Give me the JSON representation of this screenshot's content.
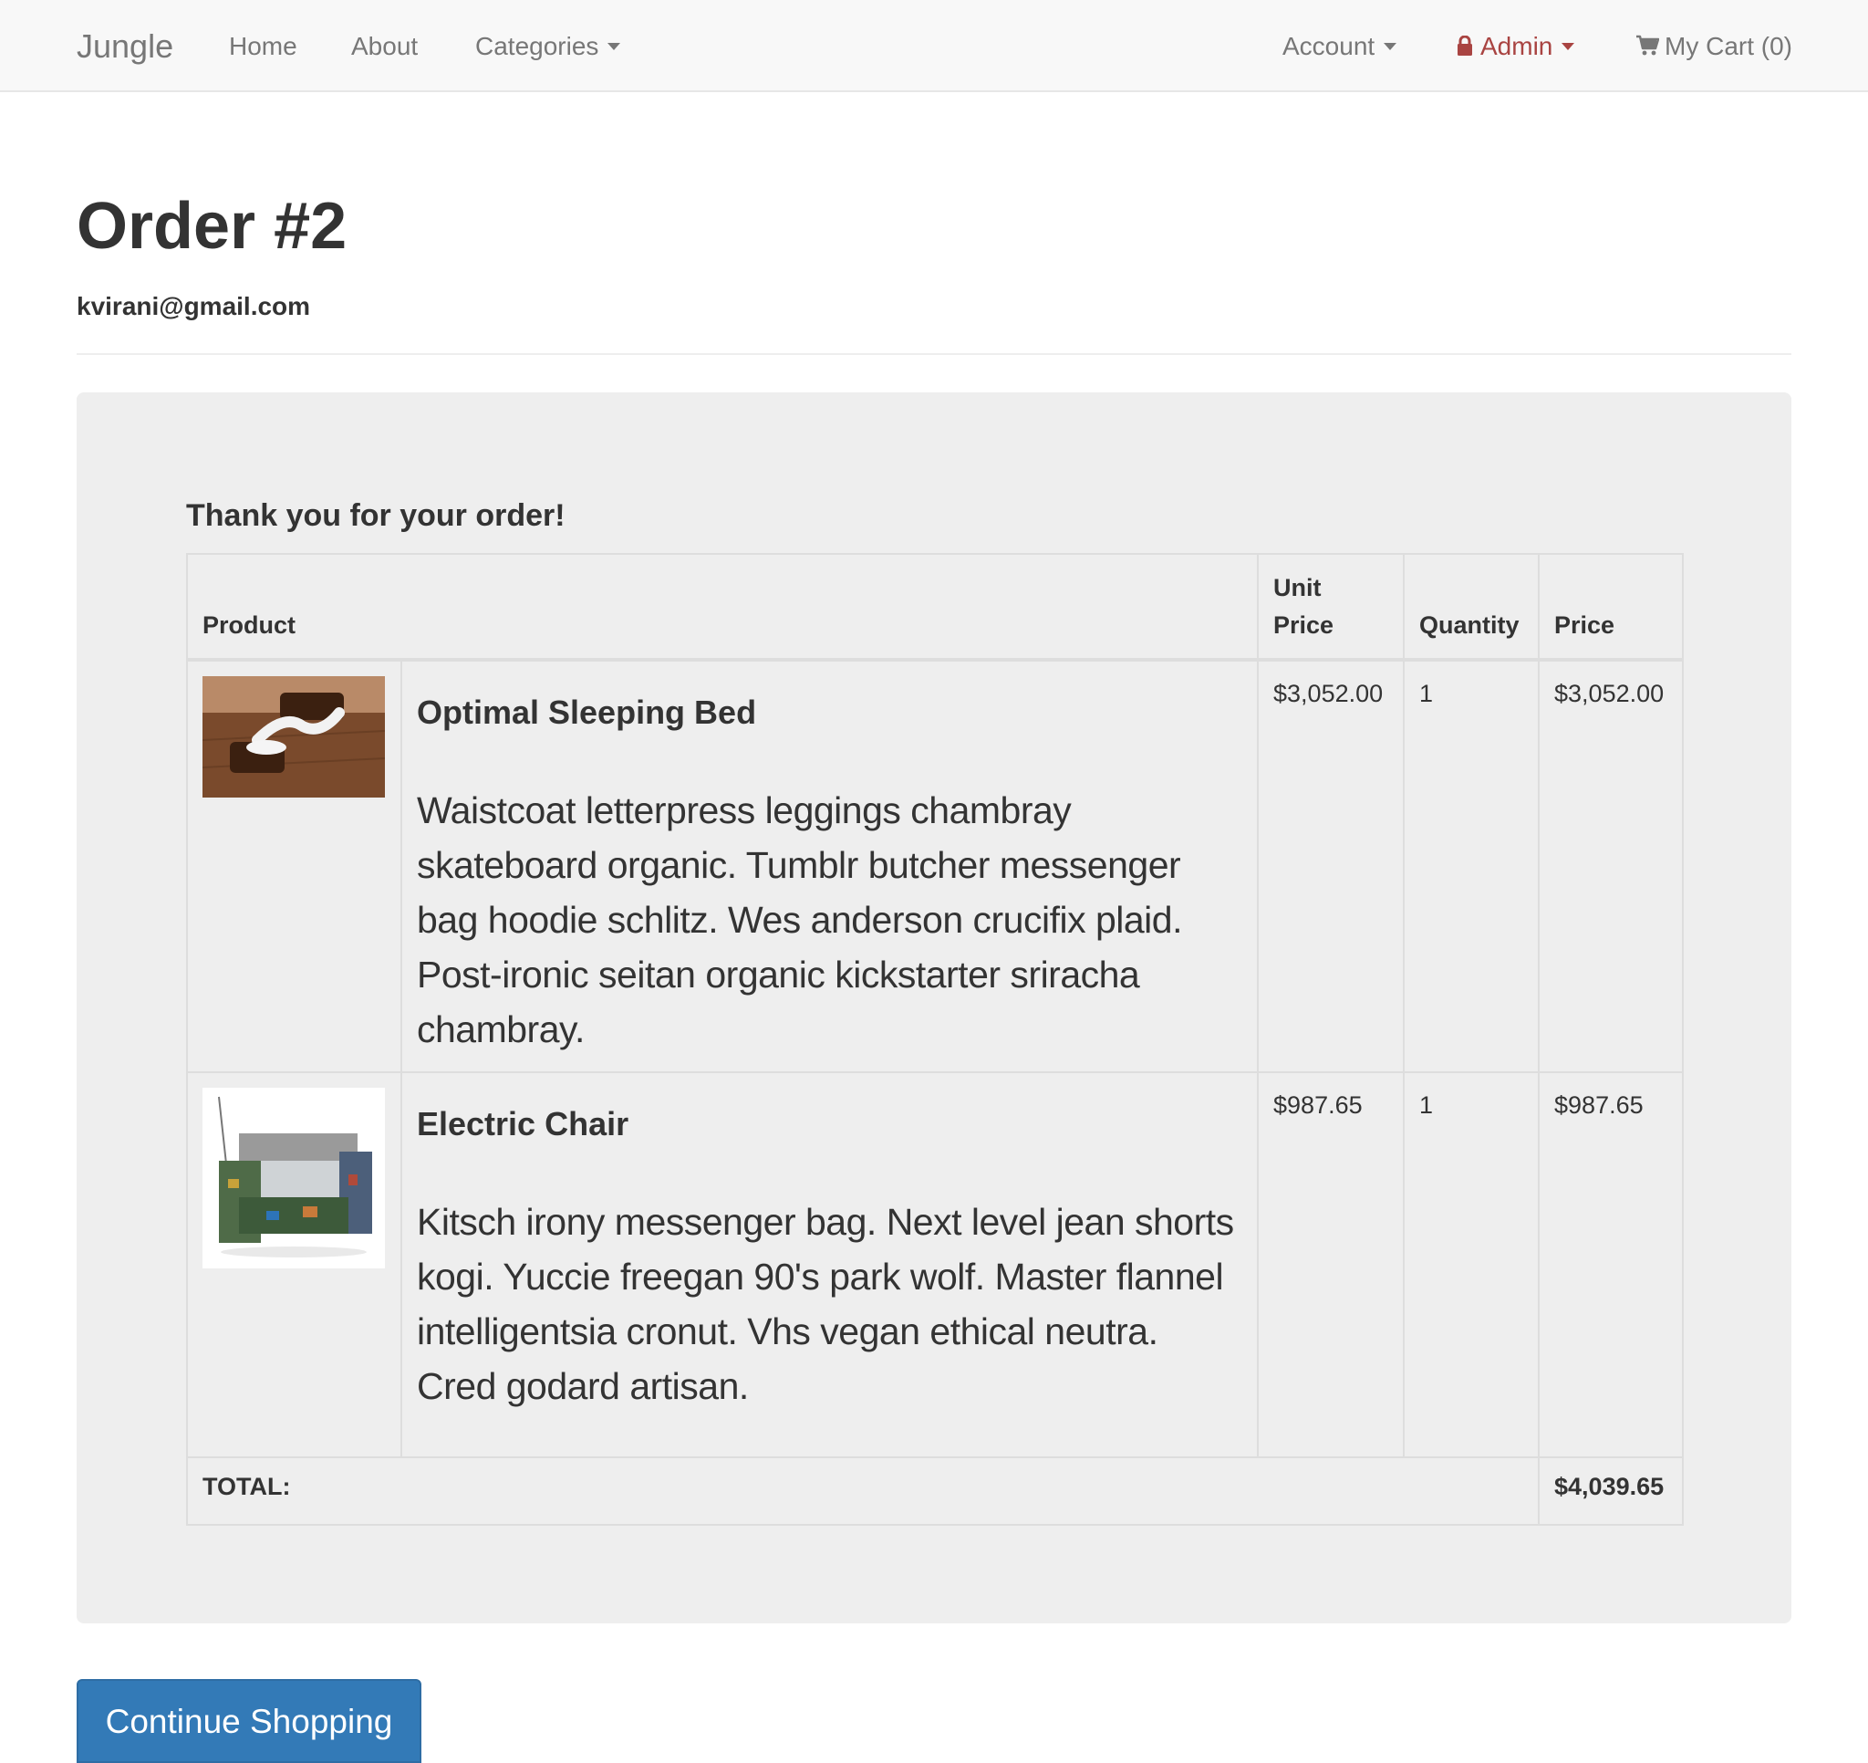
{
  "navbar": {
    "brand": "Jungle",
    "home": "Home",
    "about": "About",
    "categories": "Categories",
    "account": "Account",
    "admin": "Admin",
    "cart": "My Cart (0)"
  },
  "page": {
    "title": "Order #2",
    "email": "kvirani@gmail.com"
  },
  "order": {
    "thanks": "Thank you for your order!",
    "headers": {
      "product": "Product",
      "unit_price": "Unit Price",
      "quantity": "Quantity",
      "price": "Price"
    },
    "items": [
      {
        "name": "Optimal Sleeping Bed",
        "description": "Waistcoat letterpress leggings chambray skateboard organic. Tumblr butcher messenger bag hoodie schlitz. Wes anderson crucifix plaid. Post-ironic seitan organic kickstarter sriracha chambray.",
        "unit_price": "$3,052.00",
        "quantity": "1",
        "price": "$3,052.00"
      },
      {
        "name": "Electric Chair",
        "description": "Kitsch irony messenger bag. Next level jean shorts kogi. Yuccie freegan 90's park wolf. Master flannel intelligentsia cronut. Vhs vegan ethical neutra. Cred godard artisan.",
        "unit_price": "$987.65",
        "quantity": "1",
        "price": "$987.65"
      }
    ],
    "total_label": "TOTAL:",
    "total_value": "$4,039.65"
  },
  "actions": {
    "continue_shopping": "Continue Shopping"
  },
  "colors": {
    "navbar_bg": "#f8f8f8",
    "admin_red": "#a94442",
    "button_blue": "#337ab7",
    "panel_bg": "#eeeeee"
  },
  "icons": {
    "admin": "lock-icon",
    "cart": "shopping-cart-icon",
    "dropdown": "caret-down-icon"
  }
}
